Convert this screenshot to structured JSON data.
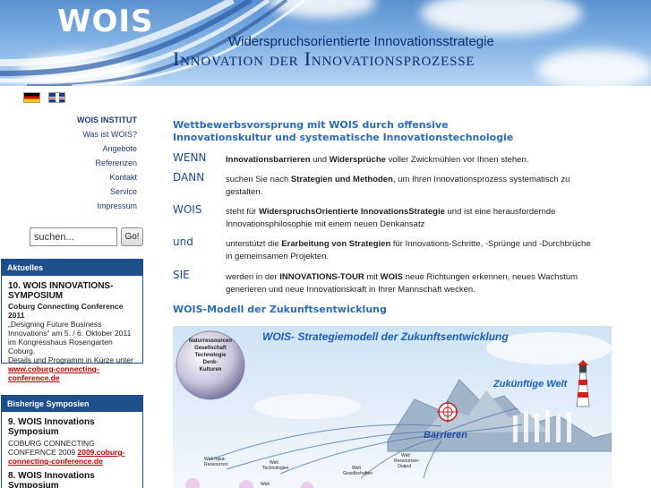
{
  "header": {
    "brand": "WOIS",
    "subtitle": "Widerspruchsorientierte Innovationsstrategie",
    "headline": "Innovation der Innovationsprozesse"
  },
  "languages": [
    "de",
    "en"
  ],
  "nav": [
    {
      "label": "WOIS INSTITUT",
      "active": true
    },
    {
      "label": "Was ist WOIS?",
      "active": false
    },
    {
      "label": "Angebote",
      "active": false
    },
    {
      "label": "Referenzen",
      "active": false
    },
    {
      "label": "Kontakt",
      "active": false
    },
    {
      "label": "Service",
      "active": false
    },
    {
      "label": "Impressum",
      "active": false
    }
  ],
  "search": {
    "value": "suchen...",
    "button": "Go!"
  },
  "news": {
    "heading": "Aktuelles",
    "title": "10. WOIS INNOVATIONS-SYMPOSIUM",
    "subtitle": "Coburg Connecting Conference 2011",
    "text1": "„Designing Future Business Innovations“ am 5. / 6. Oktober 2011 im Kongresshaus Rosengarten Coburg.",
    "text2": "Details und Programm in Kürze unter",
    "link": "www.coburg-connecting-conference.de"
  },
  "past": {
    "heading": "Bisherige Symposien",
    "entry1_title": "9. WOIS Innovations Symposium",
    "entry1_text": "COBURG CONNECTING CONFERNCE 2009",
    "entry1_link": "2009.coburg-connecting-conference.de",
    "entry2_title": "8. WOIS Innovations Symposium"
  },
  "main": {
    "headline": "Wettbewerbsvorsprung mit WOIS durch offensive Innovationskultur und systematische Innovationstechnologie",
    "rows": [
      {
        "kw": "WENN",
        "a": "Innovationsbarrieren",
        "b": " und ",
        "c": "Widersprüche",
        "d": " voller Zwickmühlen vor Ihnen stehen."
      },
      {
        "kw": "DANN",
        "a": "suchen Sie nach ",
        "b": "Strategien und Methoden",
        "c": ", um Ihren Innovationsprozess systematisch zu gestalten.",
        "d": ""
      },
      {
        "kw": "WOIS",
        "a": "steht für ",
        "b": "WiderspruchsOrientierte InnovationsStrategie",
        "c": " und ist eine herausfordernde Innovationsphilosophie mit einem neuen Denkansatz",
        "d": ""
      },
      {
        "kw": "und",
        "a": "unterstützt die ",
        "b": "Erarbeitung von Strategien",
        "c": " für Innovations-Schritte, -Sprünge und -Durchbrüche in gemeinsamen Projekten.",
        "d": ""
      },
      {
        "kw": "SIE",
        "a": "werden in der ",
        "b": "INNOVATIONS-TOUR",
        "c": " mit ",
        "d": "WOIS",
        "e": " neue Richtungen erkennen, neues Wachstum generieren und neue Innovationskraft in Ihrer Mannschaft wecken."
      }
    ],
    "model_title": "WOIS-Modell der Zukunftsentwicklung"
  },
  "figure": {
    "title": "WOIS- Strategiemodell der Zukunftsentwicklung",
    "circle_lines": [
      "Naturressourcen",
      "Gesellschaft",
      "Technologie",
      "Denk-",
      "Kulturen"
    ],
    "future": "Zukünftige  Welt",
    "barriers": "Barrieren",
    "labels": {
      "input": "Welt Input-\nRessourcen",
      "tech": "Welt\nTechnologien",
      "society": "Welt\nGesellschaften",
      "output": "Welt\nRessourcen-\nOutput",
      "welt": "Welt"
    },
    "colors": {
      "title": "#1a5fb4",
      "sky_top": "#cfe3f5",
      "sky_bottom": "#eef5fb",
      "barrier": "#1a4f9e"
    }
  },
  "colors": {
    "accent": "#2c6bb5",
    "nav": "#1c3a7a",
    "box": "#1f4e8c",
    "link": "#c00000"
  }
}
